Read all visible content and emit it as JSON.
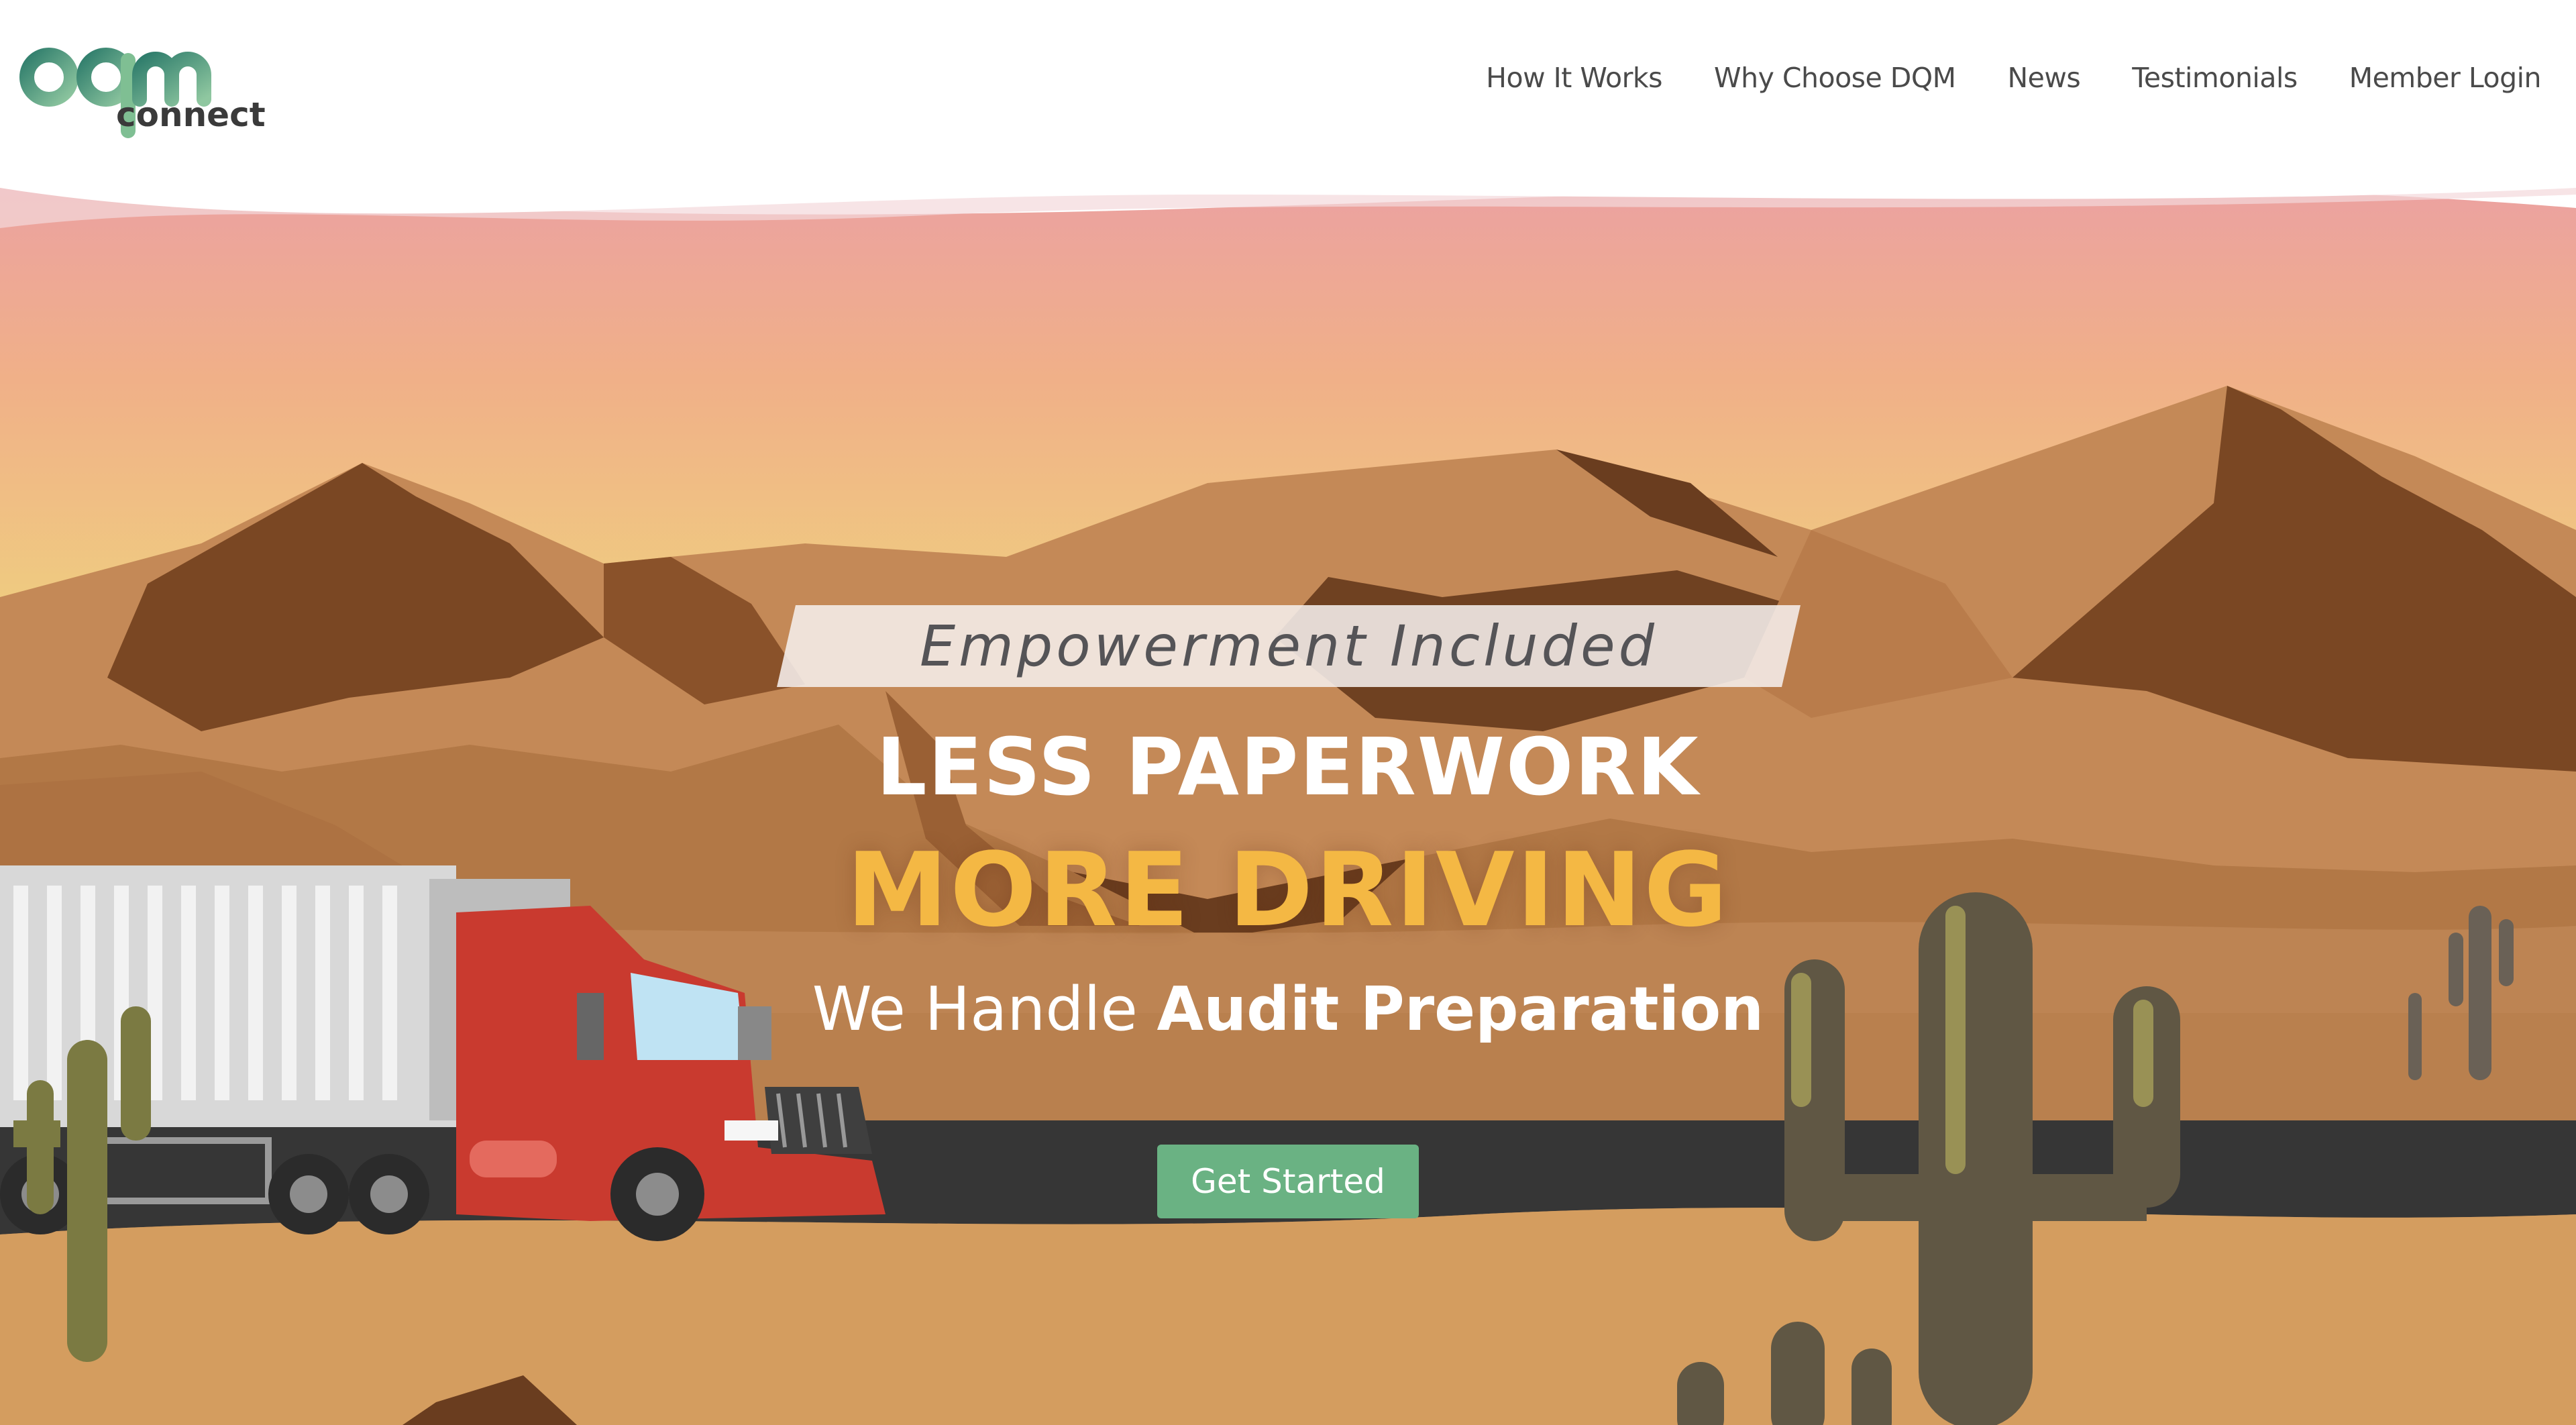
{
  "brand": {
    "logo_text": "dqm",
    "logo_subtext": "connect"
  },
  "nav": {
    "items": [
      "How It Works",
      "Why Choose DQM",
      "News",
      "Testimonials",
      "Member Login"
    ]
  },
  "hero": {
    "tagline": "Empowerment Included",
    "headline_1": "LESS PAPERWORK",
    "headline_2": "MORE DRIVING",
    "subline_prefix": "We Handle",
    "subline_bold": "Audit Preparation",
    "cta_label": "Get Started"
  },
  "colors": {
    "accent_green": "#6ab283",
    "headline_yellow": "#f4b844",
    "nav_text": "#4a4a4a",
    "road": "#363636",
    "sand": "#d49d5f"
  }
}
